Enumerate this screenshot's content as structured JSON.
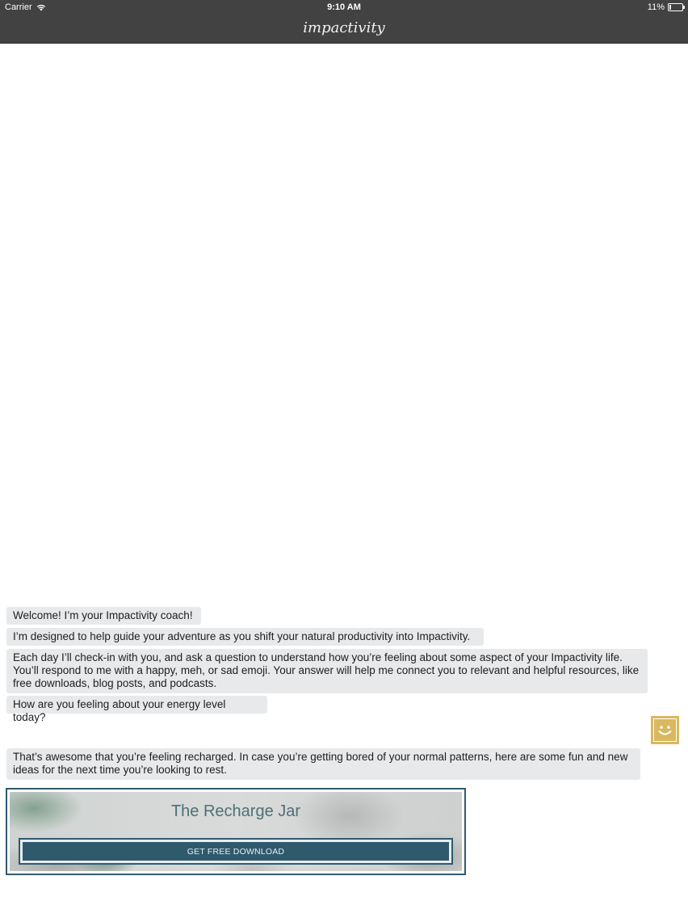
{
  "status_bar": {
    "carrier": "Carrier",
    "time": "9:10 AM",
    "battery_percent": "11%",
    "battery_level": 0.11,
    "wifi_icon": "wifi-icon",
    "battery_icon": "battery-icon"
  },
  "nav": {
    "title": "impactivity"
  },
  "messages": [
    "Welcome! I’m your Impactivity coach!",
    "I’m designed to help guide your adventure as you shift your natural productivity into Impactivity.",
    "Each day I’ll check-in with you, and ask a question to understand how you’re feeling about some aspect of your Impactivity life. You’ll respond to me with a happy, meh, or sad emoji. Your answer will help me connect you to relevant and helpful resources, like free downloads, blog posts, and podcasts.",
    "How are you feeling about your energy level today?",
    "That’s awesome that you’re feeling recharged. In case you’re getting bored of your normal patterns, here are some fun and new ideas for the next time you’re looking to rest."
  ],
  "user_reply": {
    "icon": "happy-face-icon",
    "color": "#d9b860"
  },
  "resource_card": {
    "title": "The Recharge Jar",
    "button_label": "GET FREE DOWNLOAD"
  },
  "colors": {
    "bar_background": "#424242",
    "bubble_background": "#e7e9eb",
    "accent": "#2f5a6e",
    "emoji_gold": "#d9b860"
  }
}
